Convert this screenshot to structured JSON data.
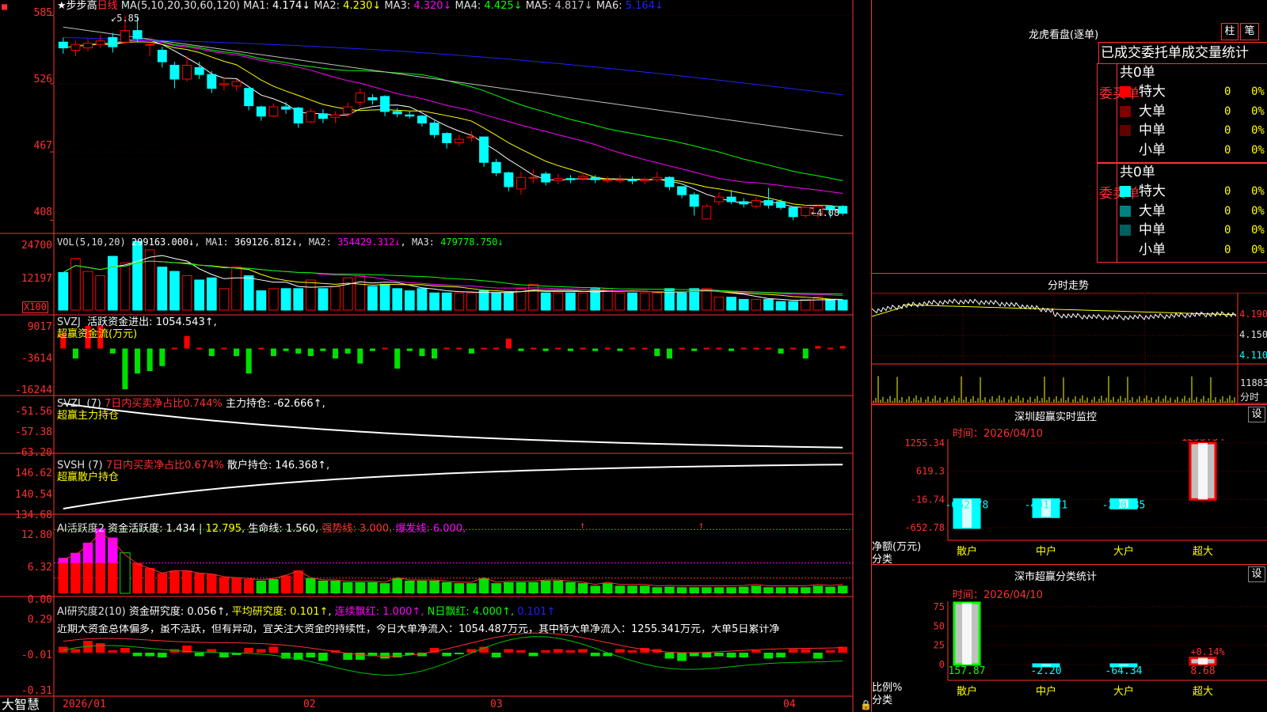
{
  "colors": {
    "up": "#ff0000",
    "down": "#00ffff",
    "ma1": "#ffffff",
    "ma2": "#ffff00",
    "ma3": "#ff00ff",
    "ma4": "#00ff00",
    "ma5": "#c0c0c0",
    "ma6": "#2020ff"
  },
  "price": {
    "icon": "square-icon",
    "star": "★步步高",
    "period": "日线",
    "ma_group": "MA(5,10,20,30,60,120)",
    "ma": [
      {
        "label": "MA1:",
        "value": "4.174↓",
        "color": "#ffffff"
      },
      {
        "label": "MA2:",
        "value": "4.230↓",
        "color": "#ffff00"
      },
      {
        "label": "MA3:",
        "value": "4.320↓",
        "color": "#ff00ff"
      },
      {
        "label": "MA4:",
        "value": "4.425↓",
        "color": "#00ff00"
      },
      {
        "label": "MA5:",
        "value": "4.817↓",
        "color": "#c0c0c0"
      },
      {
        "label": "MA6:",
        "value": "5.164↓",
        "color": "#2020ff"
      }
    ],
    "axis": [
      "585",
      "526",
      "467",
      "408"
    ],
    "high_label": "5.85",
    "low_label": "←4.08",
    "candles": [
      [
        5.62,
        5.57,
        5.66,
        5.52
      ],
      [
        5.55,
        5.6,
        5.63,
        5.5
      ],
      [
        5.57,
        5.61,
        5.65,
        5.54
      ],
      [
        5.6,
        5.63,
        5.68,
        5.57
      ],
      [
        5.66,
        5.58,
        5.7,
        5.53
      ],
      [
        5.62,
        5.72,
        5.85,
        5.6
      ],
      [
        5.72,
        5.65,
        5.85,
        5.62
      ],
      [
        5.6,
        5.6,
        5.66,
        5.5
      ],
      [
        5.55,
        5.45,
        5.58,
        5.4
      ],
      [
        5.42,
        5.3,
        5.45,
        5.22
      ],
      [
        5.3,
        5.42,
        5.5,
        5.28
      ],
      [
        5.4,
        5.34,
        5.45,
        5.3
      ],
      [
        5.34,
        5.22,
        5.37,
        5.18
      ],
      [
        5.25,
        5.26,
        5.32,
        5.2
      ],
      [
        5.24,
        5.28,
        5.3,
        5.2
      ],
      [
        5.22,
        5.07,
        5.22,
        5.03
      ],
      [
        5.06,
        4.98,
        5.07,
        4.94
      ],
      [
        4.98,
        5.06,
        5.09,
        4.97
      ],
      [
        5.06,
        5.04,
        5.1,
        5.0
      ],
      [
        5.05,
        4.92,
        5.06,
        4.88
      ],
      [
        4.93,
        5.02,
        5.05,
        4.92
      ],
      [
        5.0,
        4.96,
        5.04,
        4.92
      ],
      [
        4.97,
        4.99,
        5.02,
        4.92
      ],
      [
        5.0,
        5.06,
        5.1,
        4.97
      ],
      [
        5.1,
        5.18,
        5.22,
        5.06
      ],
      [
        5.14,
        5.12,
        5.17,
        5.08
      ],
      [
        5.15,
        5.02,
        5.16,
        4.98
      ],
      [
        5.02,
        5.0,
        5.05,
        4.97
      ],
      [
        4.99,
        4.98,
        5.02,
        4.96
      ],
      [
        4.98,
        4.92,
        4.99,
        4.89
      ],
      [
        4.92,
        4.82,
        4.94,
        4.79
      ],
      [
        4.83,
        4.75,
        4.84,
        4.7
      ],
      [
        4.75,
        4.78,
        4.82,
        4.72
      ],
      [
        4.8,
        4.8,
        4.85,
        4.76
      ],
      [
        4.8,
        4.58,
        4.8,
        4.54
      ],
      [
        4.58,
        4.49,
        4.61,
        4.46
      ],
      [
        4.49,
        4.37,
        4.5,
        4.33
      ],
      [
        4.35,
        4.45,
        4.5,
        4.3
      ],
      [
        4.45,
        4.45,
        4.52,
        4.4
      ],
      [
        4.48,
        4.41,
        4.5,
        4.38
      ],
      [
        4.42,
        4.44,
        4.48,
        4.39
      ],
      [
        4.44,
        4.43,
        4.47,
        4.4
      ],
      [
        4.44,
        4.46,
        4.49,
        4.42
      ],
      [
        4.45,
        4.43,
        4.47,
        4.4
      ],
      [
        4.43,
        4.43,
        4.46,
        4.4
      ],
      [
        4.43,
        4.43,
        4.47,
        4.4
      ],
      [
        4.43,
        4.42,
        4.46,
        4.39
      ],
      [
        4.42,
        4.43,
        4.45,
        4.39
      ],
      [
        4.43,
        4.45,
        4.5,
        4.41
      ],
      [
        4.45,
        4.37,
        4.46,
        4.34
      ],
      [
        4.37,
        4.3,
        4.37,
        4.27
      ],
      [
        4.3,
        4.2,
        4.32,
        4.12
      ],
      [
        4.09,
        4.2,
        4.22,
        4.09
      ],
      [
        4.24,
        4.28,
        4.32,
        4.21
      ],
      [
        4.28,
        4.24,
        4.34,
        4.22
      ],
      [
        4.24,
        4.22,
        4.27,
        4.19
      ],
      [
        4.2,
        4.25,
        4.28,
        4.18
      ],
      [
        4.25,
        4.21,
        4.36,
        4.18
      ],
      [
        4.24,
        4.19,
        4.26,
        4.17
      ],
      [
        4.19,
        4.11,
        4.2,
        4.08
      ],
      [
        4.12,
        4.19,
        4.21,
        4.1
      ],
      [
        4.12,
        4.2,
        4.22,
        4.1
      ],
      [
        4.2,
        4.17,
        4.2,
        4.1
      ],
      [
        4.2,
        4.14,
        4.21,
        4.12
      ]
    ]
  },
  "vol": {
    "title": "VOL(5,10,20)",
    "value": "299163.000↓",
    "ma": [
      {
        "label": "MA1:",
        "value": "369126.812↓",
        "color": "#ffffff"
      },
      {
        "label": "MA2:",
        "value": "354429.312↓",
        "color": "#ff00ff"
      },
      {
        "label": "MA3:",
        "value": "479778.750↓",
        "color": "#00ff00"
      }
    ],
    "axis": [
      "24700",
      "12197"
    ],
    "unit": "X100",
    "bars": [
      17.5,
      24,
      18,
      16,
      25,
      22,
      32,
      28,
      20,
      18,
      16,
      14,
      15,
      10,
      20,
      16,
      9,
      10,
      10,
      10,
      14,
      10,
      11,
      15,
      16,
      11,
      12,
      10,
      9,
      10,
      8,
      8,
      8,
      8,
      9,
      8,
      8,
      10,
      12,
      8,
      8,
      8,
      8,
      10,
      10,
      8,
      8,
      8,
      8,
      10,
      8,
      10,
      10,
      6,
      6,
      5,
      5,
      5,
      4,
      4,
      5,
      6,
      5,
      4.7
    ]
  },
  "svzj": {
    "title": "SVZJ",
    "label": "活跃资金进出:",
    "value": "1054.543↑,",
    "sub": "超赢资金流(万元)",
    "axis": [
      "9017",
      "-3614",
      "-16244"
    ],
    "bars": [
      6000,
      -4000,
      9017,
      9017,
      -2000,
      -16244,
      -10000,
      -9000,
      -7000,
      0,
      5000,
      0,
      -3000,
      0,
      -3000,
      -10000,
      0,
      -3000,
      -1000,
      -2000,
      -3000,
      -1000,
      -4000,
      -2000,
      -6000,
      -1000,
      0,
      -8000,
      -1000,
      -3000,
      -4000,
      0,
      0,
      -2000,
      0,
      0,
      4000,
      -1000,
      0,
      -1000,
      0,
      -1000,
      0,
      -1000,
      0,
      -1000,
      0,
      0,
      -3000,
      -4000,
      0,
      -1000,
      0,
      0,
      -1000,
      0,
      0,
      0,
      -2000,
      0,
      -4000,
      1000,
      0,
      1000
    ]
  },
  "svzl": {
    "title": "SVZL (7)",
    "label1": "7日内买卖净占比0.744%",
    "label2": "主力持仓:",
    "value": "-62.666↑,",
    "sub": "超赢主力持仓",
    "axis": [
      "-51.56",
      "-57.38",
      "-63.20"
    ]
  },
  "svsh": {
    "title": "SVSH (7)",
    "label1": "7日内买卖净占比0.674%",
    "label2": "散户持仓:",
    "value": "146.368↑,",
    "sub": "超赢散户持仓",
    "axis": [
      "146.62",
      "140.54",
      "134.68"
    ]
  },
  "ai1": {
    "title": "AI活跃度2",
    "label": "资金活跃度:",
    "v1": "1.434",
    "v2": "12.795",
    "label2": "生命线:",
    "v3": "1.560,",
    "label3": "强势线:",
    "v4": "3.000,",
    "label4": "爆发线:",
    "v5": "6.000,",
    "axis": [
      "12.80",
      "6.32",
      "0.00"
    ],
    "bars": [
      7,
      8,
      10,
      12.8,
      11,
      8,
      6,
      5,
      4,
      4.5,
      4.5,
      4,
      3.8,
      3.2,
      3,
      2.8,
      2.5,
      2.8,
      3.5,
      4.5,
      3,
      2.5,
      2.5,
      2.2,
      2.2,
      2.2,
      2,
      3,
      2.5,
      2.5,
      2.5,
      2.2,
      2,
      2,
      3,
      2,
      2.2,
      2.2,
      2.2,
      2.5,
      2.5,
      2.2,
      2,
      1.5,
      2,
      1.5,
      1.5,
      1.5,
      1.2,
      1.3,
      1.2,
      1.2,
      1.2,
      1.2,
      1.2,
      1.3,
      1.5,
      1.2,
      1.2,
      1.2,
      1.2,
      1.5,
      1.3,
      1.5
    ],
    "arrow_x": [
      0.66,
      0.81
    ]
  },
  "ai2": {
    "title": "AI研究度2(10)",
    "label": "资金研究度:",
    "v1": "0.056↑,",
    "label2": "平均研究度:",
    "v2": "0.101↑,",
    "label3": "连续飘红:",
    "v3": "1.000↑,",
    "label4": "N日飘红:",
    "v4": "4.000↑,",
    "v5": "0.101↑",
    "text": "近期大资金总体偏多，虽不活跃，但有异动，宜关注大资金的持续性，今日大单净流入：1054.487万元，其中特大单净流入：1255.341万元，大单5日累计净",
    "axis": [
      "0.29",
      "-0.01",
      "-0.31"
    ],
    "bars": [
      0.05,
      0.03,
      0.1,
      0.08,
      0.02,
      0.04,
      -0.03,
      -0.03,
      -0.04,
      0.03,
      0.06,
      -0.03,
      0.03,
      -0.04,
      -0.02,
      0.04,
      0.03,
      0.05,
      -0.05,
      -0.06,
      -0.04,
      -0.07,
      0.02,
      -0.06,
      -0.06,
      -0.03,
      -0.05,
      -0.04,
      -0.02,
      -0.03,
      0.04,
      -0.03,
      -0.01,
      0.03,
      0.05,
      -0.04,
      0.03,
      0.02,
      -0.03,
      0.02,
      0.03,
      0.02,
      0.03,
      -0.03,
      -0.03,
      0.03,
      0.02,
      0.04,
      0.03,
      -0.05,
      -0.07,
      -0.03,
      -0.04,
      -0.03,
      -0.04,
      -0.04,
      0.02,
      -0.05,
      -0.04,
      0.03,
      0.03,
      -0.05,
      0.02,
      0.05
    ]
  },
  "dates": [
    "2026/01",
    "02",
    "03",
    "04"
  ],
  "logo": "大智慧",
  "panel": {
    "title": "龙虎看盘(逐单)",
    "btn1": "柱",
    "btn2": "笔",
    "header": "已成交委托单成交量统计",
    "buy": {
      "side": "委买单",
      "total": "共0单",
      "rows": [
        {
          "name": "特大",
          "n": "0",
          "p": "0%"
        },
        {
          "name": "大单",
          "n": "0",
          "p": "0%"
        },
        {
          "name": "中单",
          "n": "0",
          "p": "0%"
        },
        {
          "name": "小单",
          "n": "0",
          "p": "0%"
        }
      ]
    },
    "sell": {
      "side": "委卖单",
      "total": "共0单",
      "rows": [
        {
          "name": "特大",
          "n": "0",
          "p": "0%"
        },
        {
          "name": "大单",
          "n": "0",
          "p": "0%"
        },
        {
          "name": "中单",
          "n": "0",
          "p": "0%"
        },
        {
          "name": "小单",
          "n": "0",
          "p": "0%"
        }
      ]
    }
  },
  "intraday": {
    "title": "分时走势",
    "axis": [
      "4.190",
      "4.150",
      "4.110"
    ],
    "vol_label": "11883",
    "vol_unit": "分时"
  },
  "sz_monitor": {
    "title": "深圳超赢实时监控",
    "btn": "设",
    "date": "时间：2026/04/10",
    "axis": [
      "1255.34",
      "619.3",
      "-16.74",
      "-652.78"
    ],
    "ylabel": "净额(万元)",
    "xlabel": "分类",
    "categories": [
      "散户",
      "中户",
      "大户",
      "超大"
    ],
    "values": [
      -652.78,
      -401.71,
      -200.85,
      1255.34
    ],
    "labels": [
      "-652.78",
      "-401.71",
      "-200.85",
      "1255.34"
    ]
  },
  "sz_class": {
    "title": "深市超赢分类统计",
    "btn": "设",
    "date": "时间：2026/04/10",
    "axis": [
      "75",
      "50",
      "25",
      "0"
    ],
    "ylabel": "比例%",
    "xlabel": "分类",
    "categories": [
      "散户",
      "中户",
      "大户",
      "超大"
    ],
    "values": [
      157.87,
      -2.2,
      -64.34,
      8.68
    ],
    "labels": [
      "157.87",
      "-2.20",
      "-64.34",
      "8.68"
    ],
    "extra": "+0.14%"
  }
}
